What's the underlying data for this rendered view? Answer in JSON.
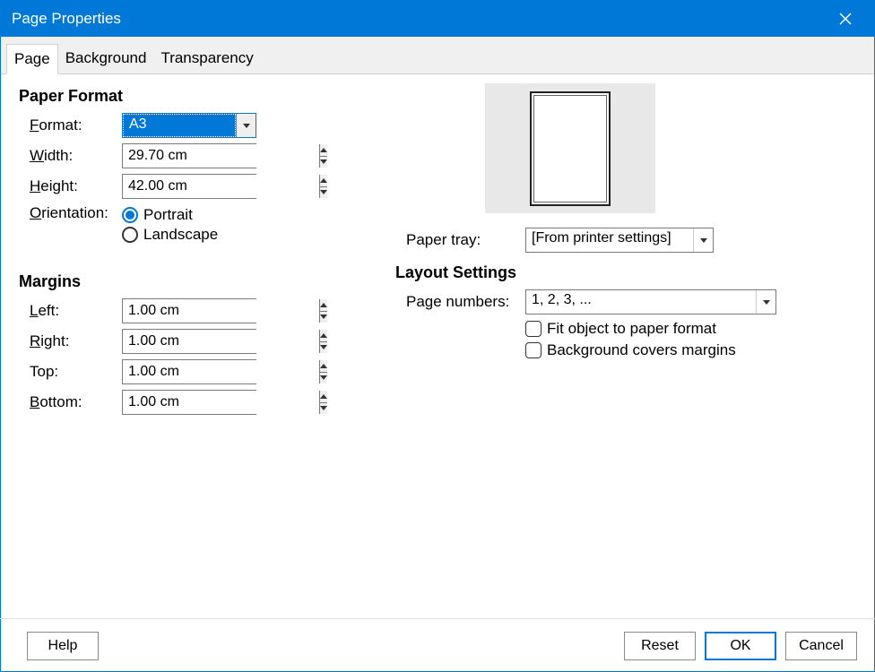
{
  "window": {
    "title": "Page Properties"
  },
  "tabs": {
    "t0": "Page",
    "t1": "Background",
    "t2": "Transparency"
  },
  "paper": {
    "heading": "Paper Format",
    "format_label_pre": "F",
    "format_label_post": "ormat:",
    "format_value": "A3",
    "width_label_pre": "W",
    "width_label_post": "idth:",
    "width_value": "29.70 cm",
    "height_label_pre": "H",
    "height_label_post": "eight:",
    "height_value": "42.00 cm",
    "orient_label_pre": "O",
    "orient_label_post": "rientation:",
    "portrait_pre": "P",
    "portrait_post": "ortrait",
    "landscape_pre": "L",
    "landscape_post": "andscape",
    "tray_label_pre": "Paper ",
    "tray_label_u": "t",
    "tray_label_post": "ray:",
    "tray_value": "[From printer settings]"
  },
  "margins": {
    "heading": "Margins",
    "left_pre": "L",
    "left_post": "eft:",
    "left_value": "1.00 cm",
    "right_pre": "R",
    "right_post": "ight:",
    "right_value": "1.00 cm",
    "top_label": "Top:",
    "top_value": "1.00 cm",
    "bottom_pre": "B",
    "bottom_post": "ottom:",
    "bottom_value": "1.00 cm"
  },
  "layout": {
    "heading": "Layout Settings",
    "pagenum_pre": "Page nu",
    "pagenum_u": "m",
    "pagenum_post": "bers:",
    "pagenum_value": "1, 2, 3, ...",
    "fit_pre": "F",
    "fit_post": "it object to paper format",
    "bg_pre": "Background ",
    "bg_u": "c",
    "bg_post": "overs margins"
  },
  "buttons": {
    "help_pre": "H",
    "help_post": "elp",
    "reset_pre": "R",
    "reset_post": "eset",
    "ok_pre": "O",
    "ok_post": "K",
    "cancel": "Cancel"
  }
}
